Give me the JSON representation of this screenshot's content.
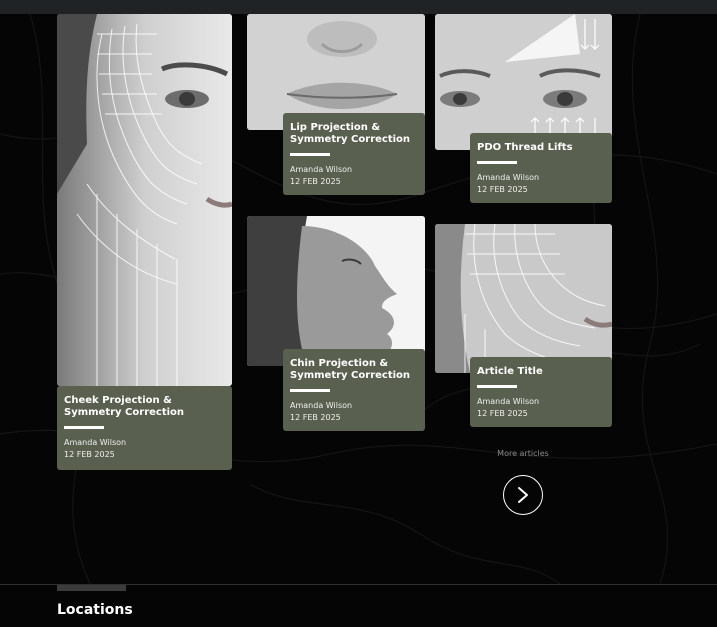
{
  "articles": [
    {
      "title": "Cheek Projection & Symmetry Correction",
      "author": "Amanda Wilson",
      "date": "12 FEB 2025"
    },
    {
      "title": "Lip Projection & Symmetry Correction",
      "author": "Amanda Wilson",
      "date": "12 FEB 2025"
    },
    {
      "title": "PDO Thread Lifts",
      "author": "Amanda Wilson",
      "date": "12 FEB 2025"
    },
    {
      "title": "Chin Projection & Symmetry Correction",
      "author": "Amanda Wilson",
      "date": "12 FEB 2025"
    },
    {
      "title": "Article Title",
      "author": "Amanda Wilson",
      "date": "12 FEB 2025"
    }
  ],
  "more": {
    "label": "More articles",
    "icon": "chevron-right-icon"
  },
  "footer": {
    "heading": "Locations"
  },
  "colors": {
    "card_bg": "#5a604f",
    "page_bg": "#050505",
    "topbar": "#1f2326"
  }
}
